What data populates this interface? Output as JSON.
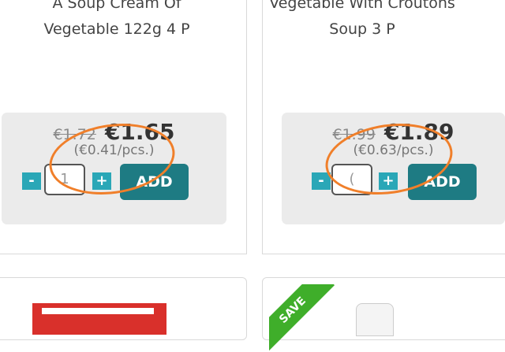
{
  "products": [
    {
      "title_line1": "A Soup Cream Of",
      "title_line2": "Vegetable 122g 4 P",
      "old_price": "€1.72",
      "new_price": "€1.65",
      "unit_price": "(€0.41/pcs.)",
      "quantity": "1",
      "minus_label": "-",
      "plus_label": "+",
      "add_label": "ADD"
    },
    {
      "title_line1": "Vegetable With Croutons",
      "title_line2": "Soup 3 P",
      "old_price": "€1.99",
      "new_price": "€1.89",
      "unit_price": "(€0.63/pcs.)",
      "quantity": "(",
      "minus_label": "-",
      "plus_label": "+",
      "add_label": "ADD"
    }
  ],
  "bottom_cards": [
    {
      "badge": ""
    },
    {
      "badge": "SAVE"
    }
  ],
  "colors": {
    "accent": "#2aa7b7",
    "add_button": "#1e7b83",
    "highlight": "#f07f2a",
    "save_badge": "#3fae2a"
  }
}
